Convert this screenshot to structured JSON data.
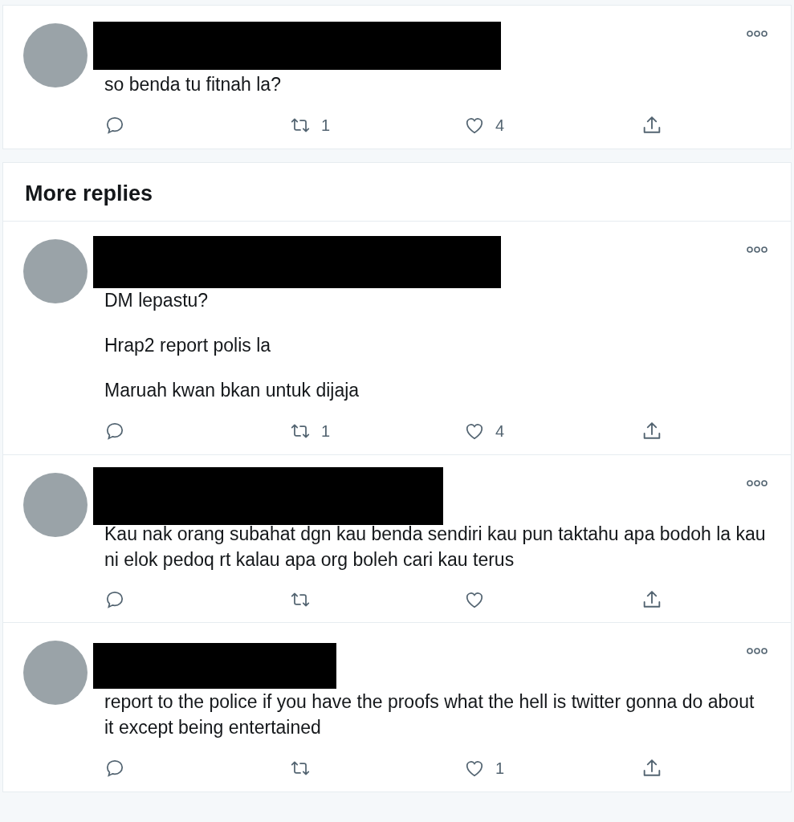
{
  "top_tweets": [
    {
      "paragraphs": [
        "so benda tu fitnah la?"
      ],
      "retweets": "1",
      "likes": "4"
    }
  ],
  "section_title": "More replies",
  "replies": [
    {
      "paragraphs": [
        "DM lepastu?",
        "Hrap2 report polis la",
        "Maruah kwan bkan untuk dijaja"
      ],
      "retweets": "1",
      "likes": "4"
    },
    {
      "paragraphs": [
        "Kau nak orang subahat dgn kau benda sendiri kau pun taktahu apa bodoh la kau ni elok pedoq rt kalau apa org boleh cari kau terus"
      ]
    },
    {
      "paragraphs": [
        "report to the police if you have the proofs what the hell is twitter gonna do about it except being entertained"
      ],
      "likes": "1"
    }
  ]
}
